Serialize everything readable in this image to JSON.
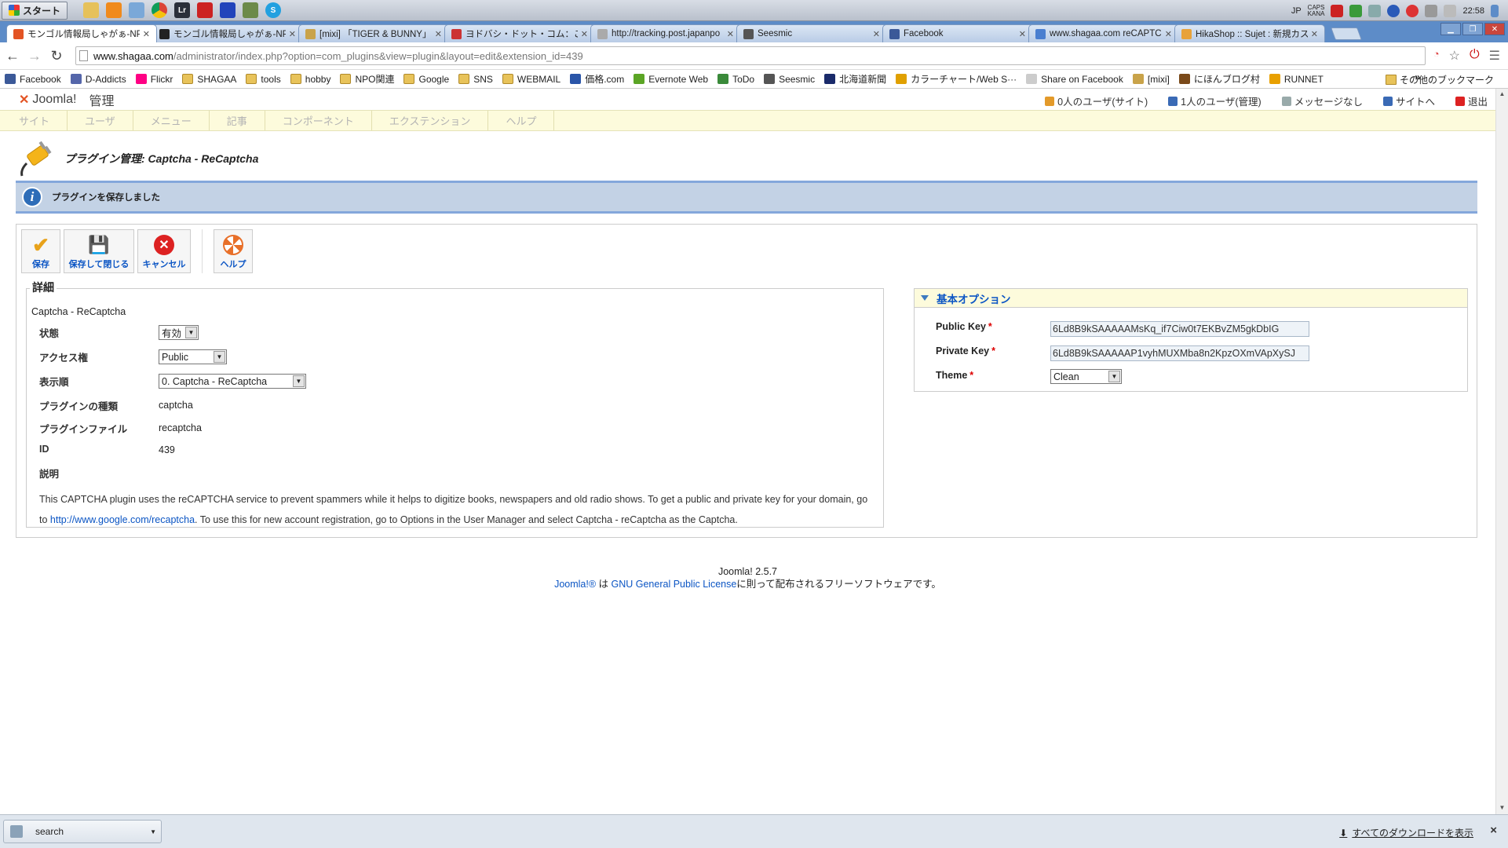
{
  "taskbar": {
    "start_label": "スタート",
    "tray": {
      "lang": "JP",
      "caps": "CAPS",
      "kana": "KANA",
      "time": "22:58"
    }
  },
  "browser": {
    "tabs": [
      {
        "title": "モンゴル情報局しゃがぁ-NPO",
        "active": true,
        "favicon": "joomla-icon",
        "color": "#e35424"
      },
      {
        "title": "モンゴル情報局しゃがぁ-NPO",
        "active": false,
        "favicon": "joomla-icon",
        "color": "#222"
      },
      {
        "title": "[mixi] 「TIGER & BUNNY」",
        "active": false,
        "favicon": "mixi-icon",
        "color": "#c9a34a"
      },
      {
        "title": "ヨドバシ・ドット・コム：ご注文商",
        "active": false,
        "favicon": "gmail-icon",
        "color": "#c33"
      },
      {
        "title": "http://tracking.post.japanpo",
        "active": false,
        "favicon": "page-icon",
        "color": "#aaa"
      },
      {
        "title": "Seesmic",
        "active": false,
        "favicon": "seesmic-icon",
        "color": "#555"
      },
      {
        "title": "Facebook",
        "active": false,
        "favicon": "facebook-icon",
        "color": "#3b5998"
      },
      {
        "title": "www.shagaa.com reCAPTCH",
        "active": false,
        "favicon": "google-icon",
        "color": "#4a7fd0"
      },
      {
        "title": "HikaShop :: Sujet : 新規カス",
        "active": false,
        "favicon": "hikashop-icon",
        "color": "#e8a23a"
      }
    ],
    "url_host": "www.shagaa.com",
    "url_path": "/administrator/index.php?option=com_plugins&view=plugin&layout=edit&extension_id=439",
    "bookmarks": [
      {
        "label": "Facebook",
        "icon": "facebook-icon",
        "color": "#3b5998"
      },
      {
        "label": "D-Addicts",
        "icon": "daddicts-icon",
        "color": "#5566aa"
      },
      {
        "label": "Flickr",
        "icon": "flickr-icon",
        "color": "#ff0084"
      },
      {
        "label": "SHAGAA",
        "icon": "folder-icon",
        "color": ""
      },
      {
        "label": "tools",
        "icon": "folder-icon",
        "color": ""
      },
      {
        "label": "hobby",
        "icon": "folder-icon",
        "color": ""
      },
      {
        "label": "NPO関連",
        "icon": "folder-icon",
        "color": ""
      },
      {
        "label": "Google",
        "icon": "folder-icon",
        "color": ""
      },
      {
        "label": "SNS",
        "icon": "folder-icon",
        "color": ""
      },
      {
        "label": "WEBMAIL",
        "icon": "folder-icon",
        "color": ""
      },
      {
        "label": "価格.com",
        "icon": "kakaku-icon",
        "color": "#2a55a8"
      },
      {
        "label": "Evernote Web",
        "icon": "evernote-icon",
        "color": "#5ba525"
      },
      {
        "label": "ToDo",
        "icon": "check-icon",
        "color": "#3a8a3a"
      },
      {
        "label": "Seesmic",
        "icon": "seesmic-icon",
        "color": "#555"
      },
      {
        "label": "北海道新聞",
        "icon": "doshin-icon",
        "color": "#1a2a6a"
      },
      {
        "label": "カラーチャート/Web S···",
        "icon": "colorchart-icon",
        "color": "#e0a000"
      },
      {
        "label": "Share on Facebook",
        "icon": "page-icon",
        "color": "#ccc"
      },
      {
        "label": "[mixi]",
        "icon": "mixi-icon",
        "color": "#c9a34a"
      },
      {
        "label": "にほんブログ村",
        "icon": "blogmura-icon",
        "color": "#7a4a1a"
      },
      {
        "label": "RUNNET",
        "icon": "runnet-icon",
        "color": "#e8a000"
      }
    ],
    "bookmarks_more": "»",
    "bookmarks_other": "その他のブックマーク"
  },
  "joomla": {
    "logo": "Joomla!",
    "admin_label": "管理",
    "status": [
      {
        "label": "0人のユーザ(サイト)",
        "icon": "users-icon",
        "color": "#e39a2a"
      },
      {
        "label": "1人のユーザ(管理)",
        "icon": "admin-users-icon",
        "color": "#3a6ab5"
      },
      {
        "label": "メッセージなし",
        "icon": "message-icon",
        "color": "#9aa"
      },
      {
        "label": "サイトへ",
        "icon": "site-icon",
        "color": "#3a6ab5"
      },
      {
        "label": "退出",
        "icon": "logout-icon",
        "color": "#d22"
      }
    ],
    "menu": [
      "サイト",
      "ユーザ",
      "メニュー",
      "記事",
      "コンポーネント",
      "エクステンション",
      "ヘルプ"
    ],
    "page_title": "プラグイン管理: Captcha - ReCaptcha",
    "message": "プラグインを保存しました",
    "toolbar": {
      "save": "保存",
      "save_close": "保存して閉じる",
      "cancel": "キャンセル",
      "help": "ヘルプ"
    },
    "details": {
      "legend": "詳細",
      "subtitle": "Captcha - ReCaptcha",
      "status_label": "状態",
      "status_value": "有効",
      "access_label": "アクセス権",
      "access_value": "Public",
      "order_label": "表示順",
      "order_value": "0. Captcha - ReCaptcha",
      "type_label": "プラグインの種類",
      "type_value": "captcha",
      "file_label": "プラグインファイル",
      "file_value": "recaptcha",
      "id_label": "ID",
      "id_value": "439",
      "desc_label": "説明",
      "desc_before": "This CAPTCHA plugin uses the reCAPTCHA service to prevent spammers while it helps to digitize books, newspapers and old radio shows. To get a public and private key for your domain, go to ",
      "desc_link": "http://www.google.com/recaptcha",
      "desc_after": ". To use this for new account registration, go to Options in the User Manager and select Captcha - reCaptcha as the Captcha."
    },
    "options": {
      "header": "基本オプション",
      "public_key_label": "Public Key",
      "public_key_value": "6Ld8B9kSAAAAAMsKq_if7Ciw0t7EKBvZM5gkDbIG",
      "private_key_label": "Private Key",
      "private_key_value": "6Ld8B9kSAAAAAP1vyhMUXMba8n2KpzOXmVApXySJ",
      "theme_label": "Theme",
      "theme_value": "Clean",
      "required_mark": "*"
    },
    "footer": {
      "version": "Joomla! 2.5.7",
      "link1": "Joomla!®",
      "mid": " は ",
      "link2": "GNU General Public License",
      "after": "に則って配布されるフリーソフトウェアです。"
    }
  },
  "downloads": {
    "item": "search",
    "show_all": "すべてのダウンロードを表示",
    "close": "×"
  }
}
